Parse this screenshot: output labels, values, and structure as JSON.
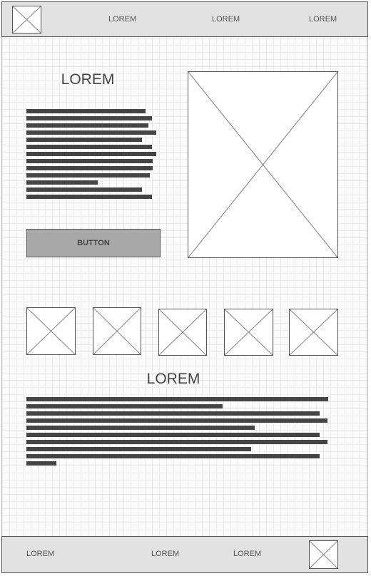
{
  "header": {
    "logo_icon": "image-placeholder-icon",
    "nav": [
      "LOREM",
      "LOREM",
      "LOREM"
    ]
  },
  "hero": {
    "title": "LOREM",
    "button_label": "BUTTON",
    "image_icon": "image-placeholder-icon"
  },
  "gallery": {
    "item_icon": "image-placeholder-icon",
    "count": 5
  },
  "section": {
    "title": "LOREM"
  },
  "footer": {
    "nav": [
      "LOREM",
      "LOREM",
      "LOREM"
    ],
    "logo_icon": "image-placeholder-icon"
  },
  "colors": {
    "bar_background": "#e2e2e2",
    "button_background": "#a9a9a9",
    "text_line": "#444444",
    "grid_line": "#ececec"
  }
}
